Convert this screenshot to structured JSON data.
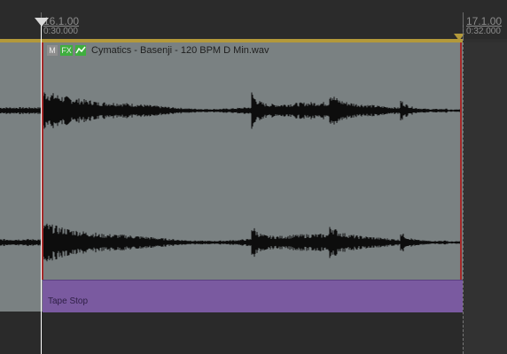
{
  "ruler": {
    "marker_left": {
      "bars": "16.1.00",
      "time": "0:30.000"
    },
    "marker_right": {
      "bars": "17.1.00",
      "time": "0:32.000"
    }
  },
  "clip": {
    "name": "Cymatics - Basenji - 120 BPM D Min.wav",
    "badges": {
      "mute": "M",
      "fx": "FX",
      "envelope": "envelope-icon"
    }
  },
  "effect": {
    "label": "Tape Stop"
  },
  "colors": {
    "loop_bar": "#b3993a",
    "clip_bg": "#7a8182",
    "effect_lane": "#7a5aa0",
    "playhead": "#ffffff",
    "badge_green": "#3fae3f"
  }
}
